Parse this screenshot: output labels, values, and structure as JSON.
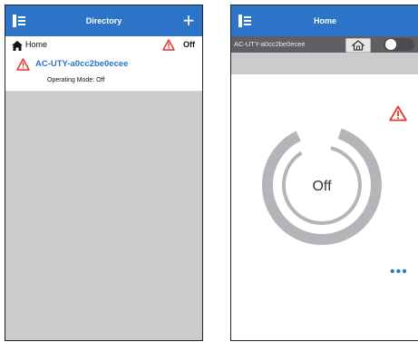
{
  "left_screen": {
    "title": "Directory",
    "home": {
      "label": "Home",
      "status": "Off"
    },
    "device": {
      "name": "AC-UTY-a0cc2be0ecee",
      "operating_mode": "Operating Mode: Off"
    }
  },
  "right_screen": {
    "title": "Home",
    "device_name": "AC-UTY-a0cc2be0ecee",
    "power_state": "Off"
  },
  "colors": {
    "brand_blue": "#2b74c8",
    "warning_red": "#e2362b",
    "dark_bar": "#5e6063",
    "grey_background": "#c9cbcd"
  },
  "icons": {
    "menu": "menu-icon",
    "add": "plus-icon",
    "home": "home-icon",
    "warning": "warning-icon",
    "more": "more-options-icon"
  }
}
